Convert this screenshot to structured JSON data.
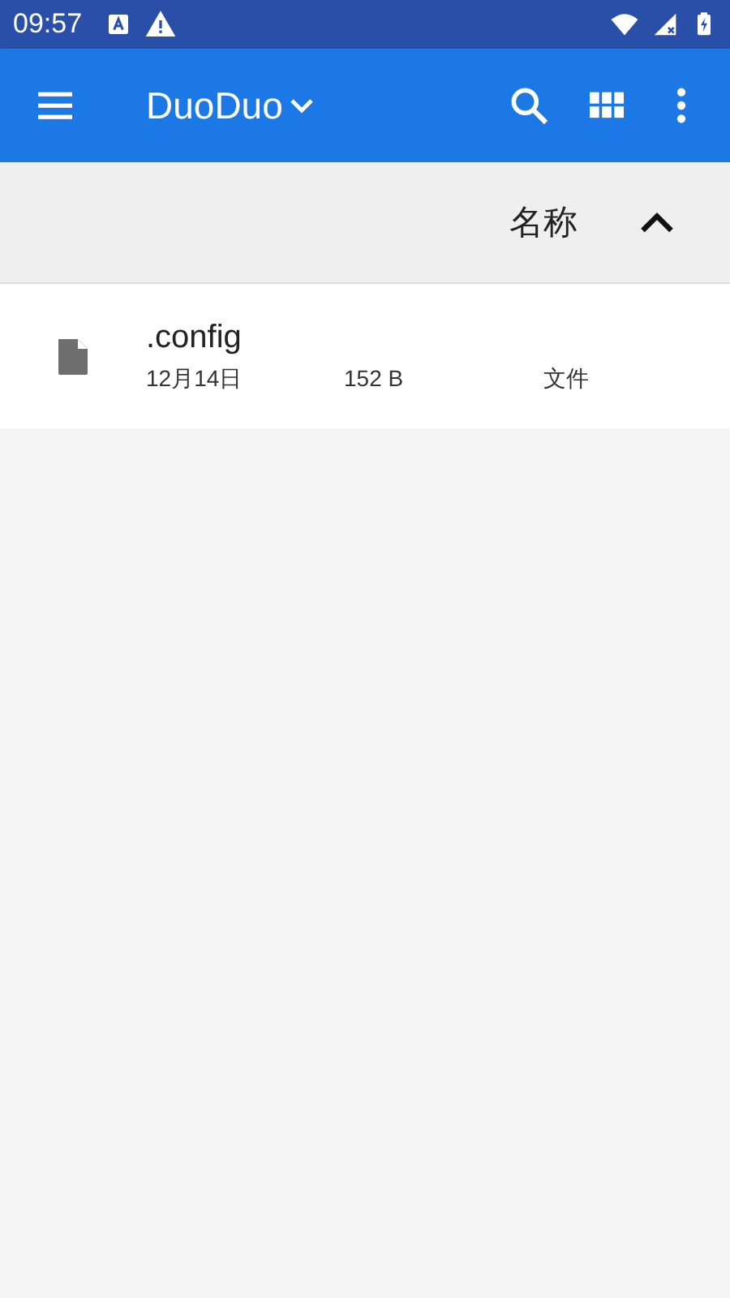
{
  "status_bar": {
    "time": "09:57"
  },
  "toolbar": {
    "title": "DuoDuo"
  },
  "sort_header": {
    "label": "名称",
    "ascending": true
  },
  "files": [
    {
      "name": ".config",
      "date": "12月14日",
      "size": "152 B",
      "type": "文件"
    }
  ]
}
